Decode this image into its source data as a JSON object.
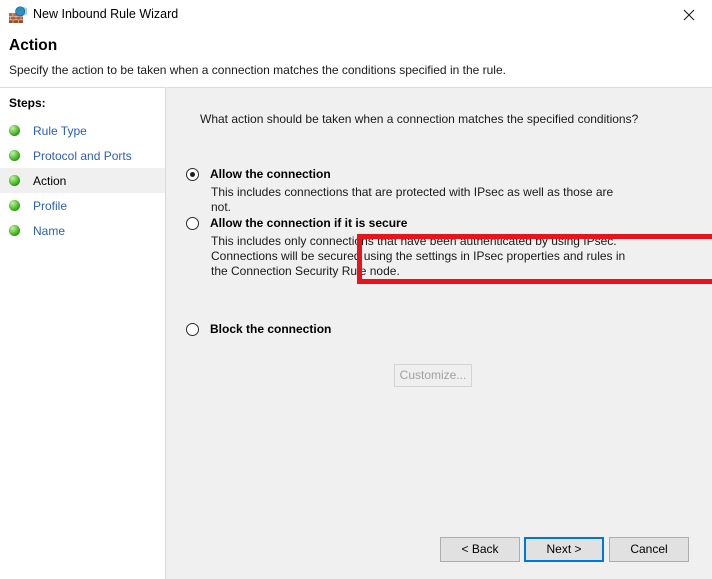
{
  "window": {
    "title": "New Inbound Rule Wizard",
    "icon": "firewall-globe-icon",
    "close_label": "✕"
  },
  "header": {
    "title": "Action",
    "subtitle": "Specify the action to be taken when a connection matches the conditions specified in the rule."
  },
  "sidebar": {
    "label": "Steps:",
    "items": [
      {
        "label": "Rule Type",
        "state": "completed"
      },
      {
        "label": "Protocol and Ports",
        "state": "completed"
      },
      {
        "label": "Action",
        "state": "current"
      },
      {
        "label": "Profile",
        "state": "completed"
      },
      {
        "label": "Name",
        "state": "completed"
      }
    ]
  },
  "main": {
    "question": "What action should be taken when a connection matches the specified conditions?",
    "options": [
      {
        "label": "Allow the connection",
        "description": "This includes connections that are protected with IPsec as well as those are not.",
        "selected": true
      },
      {
        "label": "Allow the connection if it is secure",
        "description": "This includes only connections that have been authenticated by using IPsec.  Connections will be secured using the settings in IPsec properties and rules in the Connection Security Rule node.",
        "selected": false
      },
      {
        "label": "Block the connection",
        "description": "",
        "selected": false
      }
    ],
    "customize_button": {
      "label": "Customize...",
      "enabled": false
    },
    "highlight_color": "#e8141c"
  },
  "footer": {
    "back_label": "< Back",
    "next_label": "Next >",
    "cancel_label": "Cancel",
    "default_button": "Next >",
    "accent_color": "#0078d7"
  }
}
